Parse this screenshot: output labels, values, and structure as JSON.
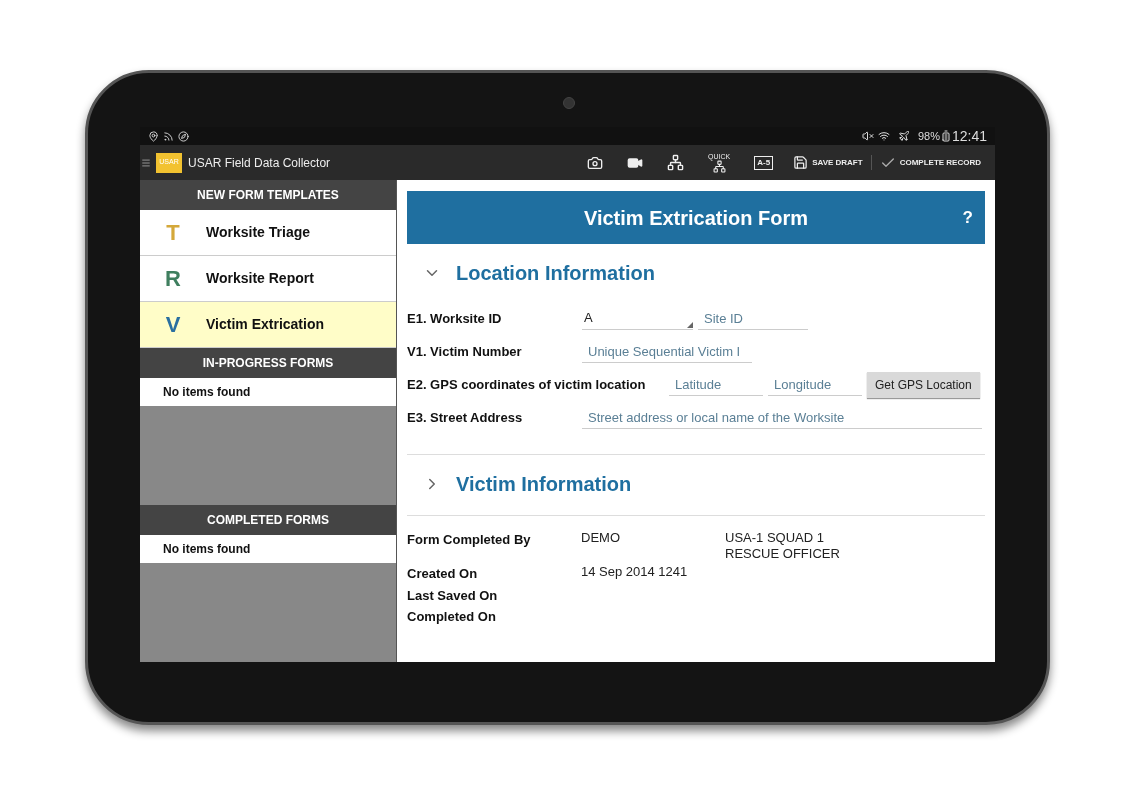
{
  "status_bar": {
    "battery": "98%",
    "time": "12:41"
  },
  "app_bar": {
    "logo": "USAR",
    "title": "USAR Field Data Collector",
    "actions": [
      {
        "kind": "camera"
      },
      {
        "kind": "video"
      },
      {
        "kind": "hierarchy"
      },
      {
        "kind": "quick",
        "label": "QUICK"
      },
      {
        "kind": "badge",
        "label": "A-5"
      },
      {
        "kind": "save",
        "label": "SAVE DRAFT"
      },
      {
        "kind": "complete",
        "label": "COMPLETE RECORD"
      }
    ]
  },
  "sidebar": {
    "sections": [
      {
        "title": "NEW FORM TEMPLATES",
        "items": [
          {
            "letter": "T",
            "color": "#d4a83a",
            "label": "Worksite Triage",
            "selected": false
          },
          {
            "letter": "R",
            "color": "#3f7f5f",
            "label": "Worksite Report",
            "selected": false
          },
          {
            "letter": "V",
            "color": "#2a6fa0",
            "label": "Victim Extrication",
            "selected": true
          }
        ]
      },
      {
        "title": "IN-PROGRESS FORMS",
        "empty_text": "No items found"
      },
      {
        "title": "COMPLETED FORMS",
        "empty_text": "No items found"
      }
    ]
  },
  "form": {
    "title": "Victim Extrication Form",
    "help": "?",
    "sections": [
      {
        "title": "Location Information",
        "expanded": true,
        "fields": [
          {
            "label": "E1. Worksite ID",
            "inputs": [
              {
                "kind": "dropdown",
                "value": "A"
              },
              {
                "kind": "text",
                "placeholder": "Site ID"
              }
            ]
          },
          {
            "label": "V1. Victim Number",
            "inputs": [
              {
                "kind": "text",
                "placeholder": "Unique Sequential Victim I"
              }
            ]
          },
          {
            "label": "E2. GPS coordinates of victim location",
            "inputs": [
              {
                "kind": "text",
                "placeholder": "Latitude"
              },
              {
                "kind": "text",
                "placeholder": "Longitude"
              },
              {
                "kind": "button",
                "label": "Get GPS Location"
              }
            ]
          },
          {
            "label": "E3. Street Address",
            "inputs": [
              {
                "kind": "wide",
                "placeholder": "Street address or local name of the Worksite"
              }
            ]
          }
        ]
      },
      {
        "title": "Victim Information",
        "expanded": false
      }
    ],
    "meta": [
      {
        "label": "Form Completed By",
        "values": [
          "DEMO",
          "USA-1 SQUAD 1\nRESCUE OFFICER"
        ]
      },
      {
        "label": "Created On",
        "values": [
          "14 Sep 2014 1241"
        ]
      },
      {
        "label": "Last Saved On"
      },
      {
        "label": "Completed On"
      }
    ]
  }
}
